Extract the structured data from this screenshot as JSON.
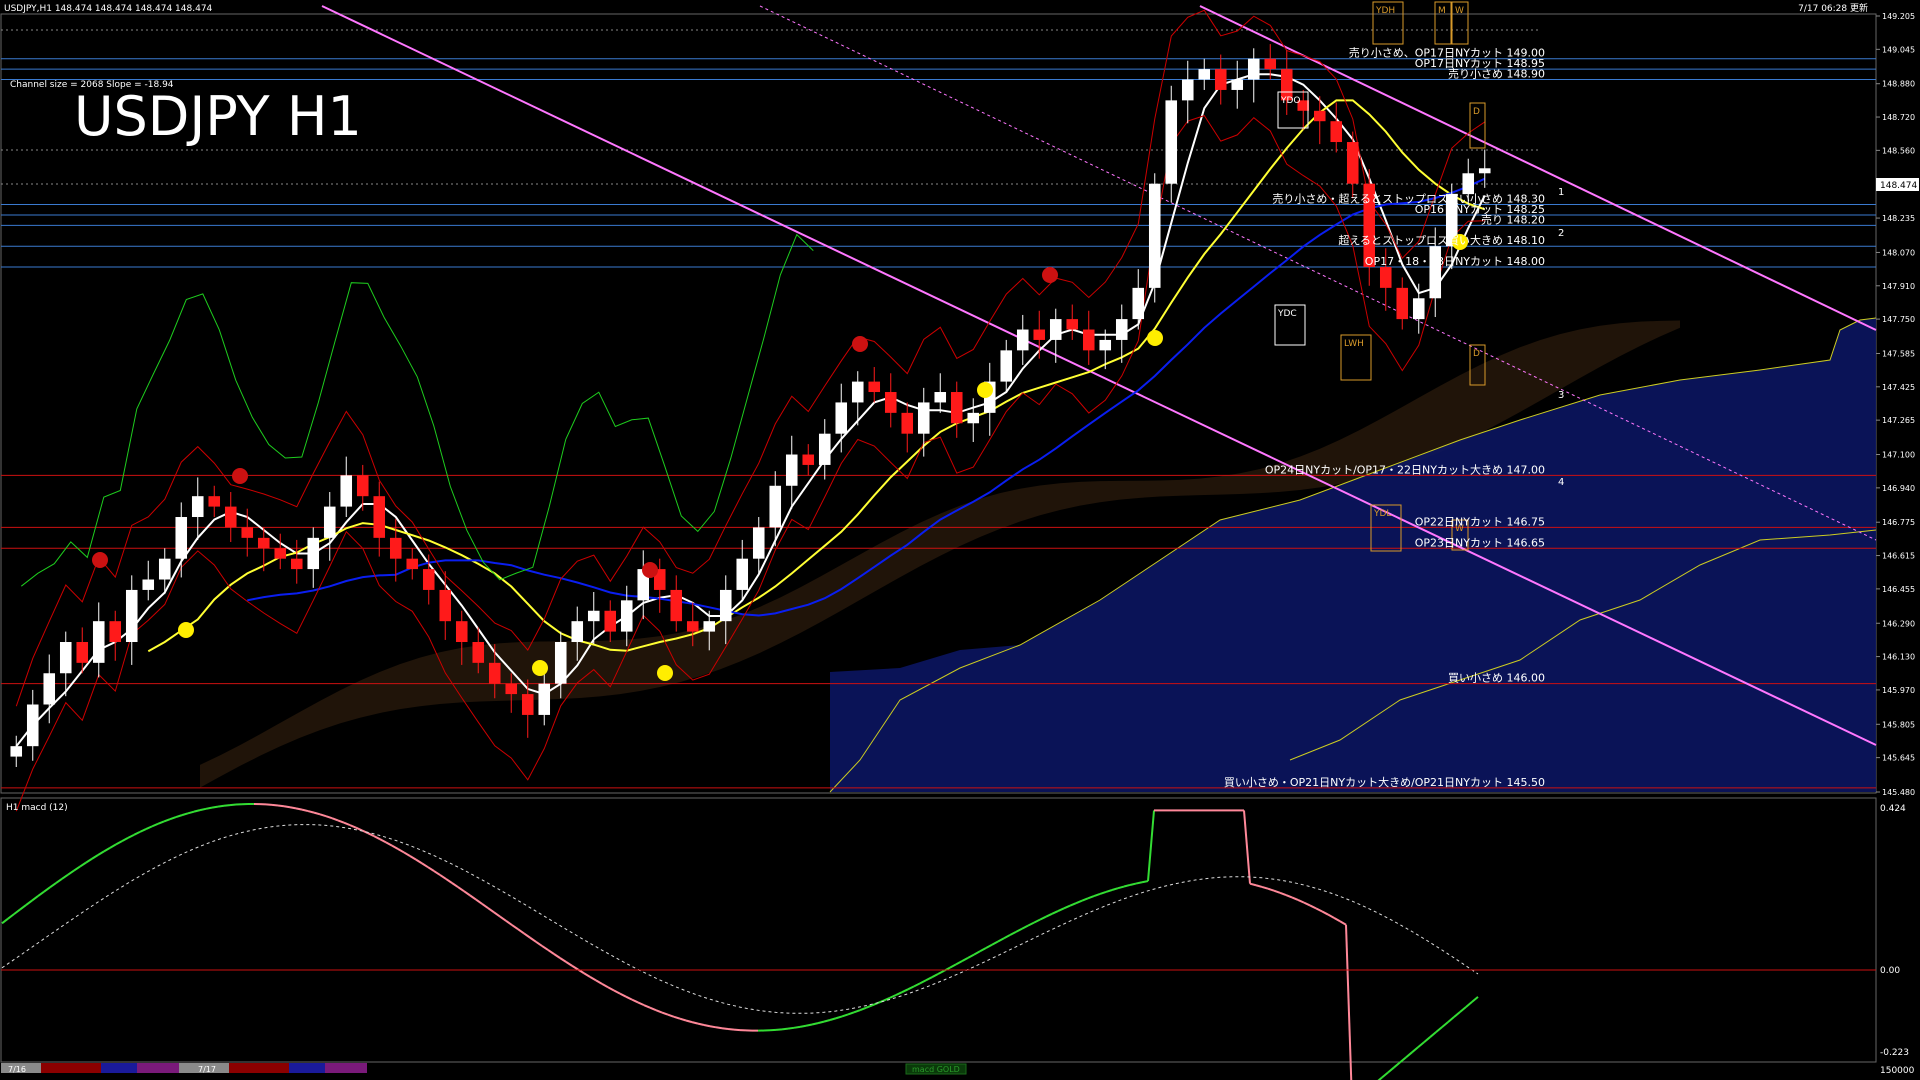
{
  "header": {
    "symbol_line": "USDJPY,H1  148.474 148.474 148.474 148.474",
    "datetime": "7/17 06:28 更新"
  },
  "big_title": "USDJPY H1",
  "channel_info": "Channel size = 2068 Slope = -18.94",
  "current_price": "148.474",
  "price_axis": [
    "149.205",
    "149.045",
    "148.880",
    "148.720",
    "148.560",
    "148.395",
    "148.235",
    "148.070",
    "147.910",
    "147.750",
    "147.585",
    "147.425",
    "147.265",
    "147.100",
    "146.940",
    "146.775",
    "146.615",
    "146.455",
    "146.290",
    "146.130",
    "145.970",
    "145.805",
    "145.645",
    "145.480"
  ],
  "macd_panel": {
    "label": "H1  macd (12)",
    "axis": [
      "0.424",
      "0.00",
      "-0.223"
    ]
  },
  "bottom_bar": {
    "date1": "7/16",
    "date2": "7/17",
    "indicator": "macd GOLD",
    "right_value": "150000"
  },
  "box_labels": {
    "ydh": "YDH",
    "m": "M",
    "w_top": "W",
    "ydo": "YDO",
    "ydc": "YDC",
    "lwh": "LWH",
    "ydl": "YDL",
    "w_low": "W",
    "d_top": "D",
    "d_low": "D"
  },
  "fib_numbers": [
    "1",
    "2",
    "3",
    "4"
  ],
  "colors": {
    "candle_up": "#ffffff",
    "candle_down": "#ff1a1a",
    "sma_fast": "#ffffff",
    "sma_mid": "#ffff33",
    "sma_slow": "#0a1ef0",
    "bollinger": "#cc0000",
    "chikou": "#1ecc1e",
    "channel": "#ff77ff",
    "cloud_band": "#1a2a9a",
    "level_blue": "#3a7ad0",
    "level_red": "#cc1111",
    "macd_pos": "#33dd33",
    "macd_neg": "#ff8899"
  },
  "chart_data": {
    "type": "candlestick",
    "symbol": "USDJPY",
    "timeframe": "H1",
    "ylim": [
      145.48,
      149.205
    ],
    "last_price": 148.474,
    "close_path": [
      145.7,
      145.9,
      146.05,
      146.2,
      146.1,
      146.3,
      146.2,
      146.45,
      146.5,
      146.6,
      146.8,
      146.9,
      146.85,
      146.75,
      146.7,
      146.65,
      146.6,
      146.55,
      146.7,
      146.85,
      147.0,
      146.9,
      146.7,
      146.6,
      146.55,
      146.45,
      146.3,
      146.2,
      146.1,
      146.0,
      145.95,
      145.85,
      146.0,
      146.2,
      146.3,
      146.35,
      146.25,
      146.4,
      146.55,
      146.45,
      146.3,
      146.25,
      146.3,
      146.45,
      146.6,
      146.75,
      146.95,
      147.1,
      147.05,
      147.2,
      147.35,
      147.45,
      147.4,
      147.3,
      147.2,
      147.35,
      147.4,
      147.25,
      147.3,
      147.45,
      147.6,
      147.7,
      147.65,
      147.75,
      147.7,
      147.6,
      147.65,
      147.75,
      147.9,
      148.4,
      148.8,
      148.9,
      148.95,
      148.85,
      148.9,
      149.0,
      148.95,
      148.8,
      148.75,
      148.7,
      148.6,
      148.4,
      148.0,
      147.9,
      147.75,
      147.85,
      148.1,
      148.35,
      148.45,
      148.474
    ],
    "price_levels": [
      {
        "price": 149.0,
        "label": "売り小さめ、OP17日NYカット 149.00"
      },
      {
        "price": 148.95,
        "label": "OP17日NYカット 148.95"
      },
      {
        "price": 148.9,
        "label": "売り小さめ 148.90"
      },
      {
        "price": 148.3,
        "label": "売り小さめ・超えるとストップロス買い小さめ 148.30"
      },
      {
        "price": 148.25,
        "label": "OP16日NYカット 148.25"
      },
      {
        "price": 148.2,
        "label": "売り 148.20"
      },
      {
        "price": 148.1,
        "label": "超えるとストップロス買い大きめ 148.10"
      },
      {
        "price": 148.0,
        "label": "OP17・18・23日NYカット 148.00"
      },
      {
        "price": 147.0,
        "label": "OP24日NYカット/OP17・22日NYカット大きめ 147.00"
      },
      {
        "price": 146.75,
        "label": "OP22日NYカット 146.75"
      },
      {
        "price": 146.65,
        "label": "OP23日NYカット 146.65"
      },
      {
        "price": 146.0,
        "label": "買い小さめ 146.00"
      },
      {
        "price": 145.5,
        "label": "買い小さめ・OP21日NYカット大きめ/OP21日NYカット 145.50"
      }
    ]
  }
}
